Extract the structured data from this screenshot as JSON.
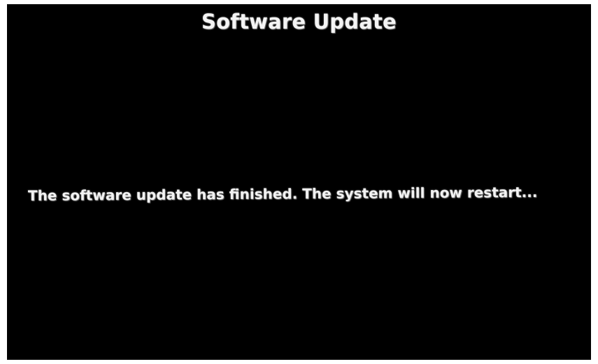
{
  "screen": {
    "title": "Software Update",
    "message": "The software update has finished. The system will now restart..."
  },
  "colors": {
    "background": "#000000",
    "text": "#f2f2f2",
    "bezel": "#ffffff"
  }
}
